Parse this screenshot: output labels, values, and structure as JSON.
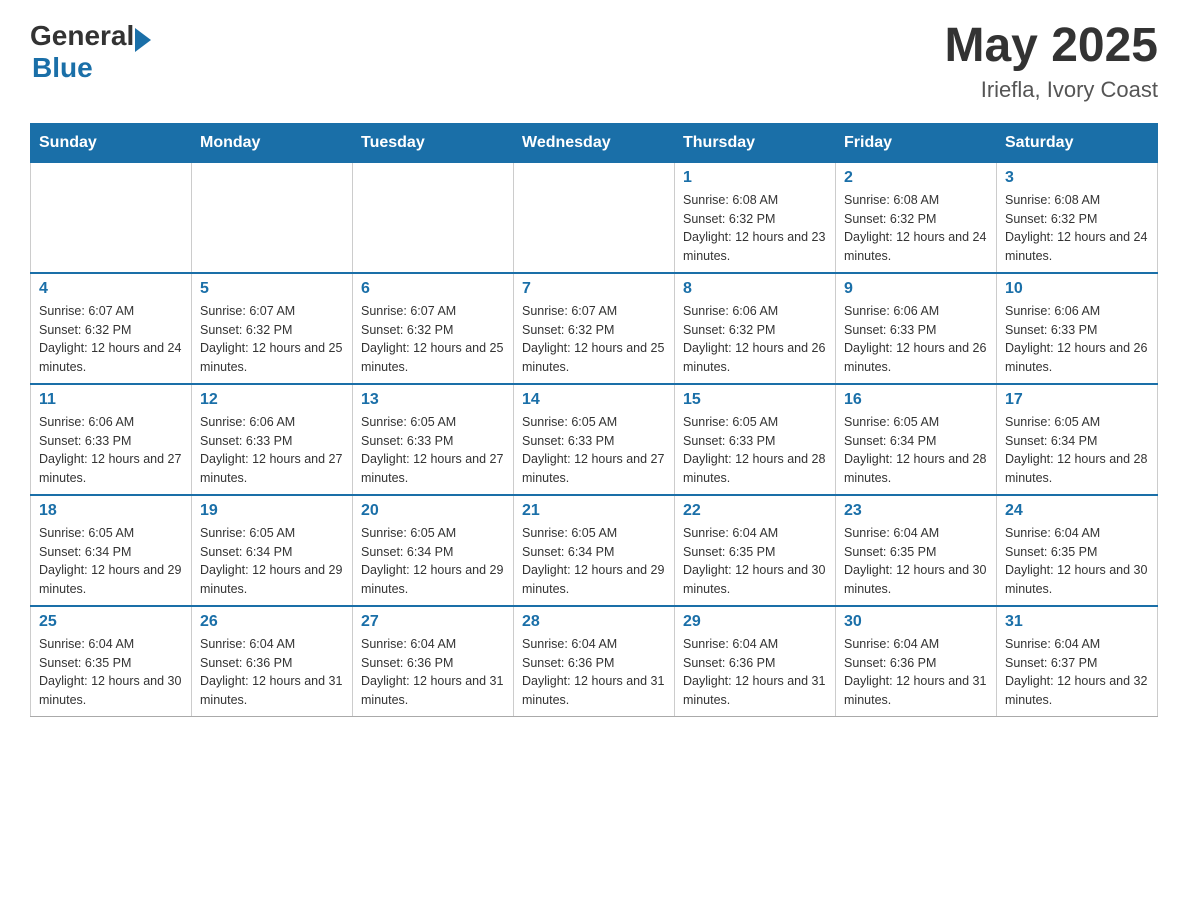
{
  "header": {
    "month_year": "May 2025",
    "location": "Iriefla, Ivory Coast",
    "logo_general": "General",
    "logo_blue": "Blue"
  },
  "days_of_week": [
    "Sunday",
    "Monday",
    "Tuesday",
    "Wednesday",
    "Thursday",
    "Friday",
    "Saturday"
  ],
  "weeks": [
    {
      "days": [
        {
          "number": "",
          "info": ""
        },
        {
          "number": "",
          "info": ""
        },
        {
          "number": "",
          "info": ""
        },
        {
          "number": "",
          "info": ""
        },
        {
          "number": "1",
          "info": "Sunrise: 6:08 AM\nSunset: 6:32 PM\nDaylight: 12 hours and 23 minutes."
        },
        {
          "number": "2",
          "info": "Sunrise: 6:08 AM\nSunset: 6:32 PM\nDaylight: 12 hours and 24 minutes."
        },
        {
          "number": "3",
          "info": "Sunrise: 6:08 AM\nSunset: 6:32 PM\nDaylight: 12 hours and 24 minutes."
        }
      ]
    },
    {
      "days": [
        {
          "number": "4",
          "info": "Sunrise: 6:07 AM\nSunset: 6:32 PM\nDaylight: 12 hours and 24 minutes."
        },
        {
          "number": "5",
          "info": "Sunrise: 6:07 AM\nSunset: 6:32 PM\nDaylight: 12 hours and 25 minutes."
        },
        {
          "number": "6",
          "info": "Sunrise: 6:07 AM\nSunset: 6:32 PM\nDaylight: 12 hours and 25 minutes."
        },
        {
          "number": "7",
          "info": "Sunrise: 6:07 AM\nSunset: 6:32 PM\nDaylight: 12 hours and 25 minutes."
        },
        {
          "number": "8",
          "info": "Sunrise: 6:06 AM\nSunset: 6:32 PM\nDaylight: 12 hours and 26 minutes."
        },
        {
          "number": "9",
          "info": "Sunrise: 6:06 AM\nSunset: 6:33 PM\nDaylight: 12 hours and 26 minutes."
        },
        {
          "number": "10",
          "info": "Sunrise: 6:06 AM\nSunset: 6:33 PM\nDaylight: 12 hours and 26 minutes."
        }
      ]
    },
    {
      "days": [
        {
          "number": "11",
          "info": "Sunrise: 6:06 AM\nSunset: 6:33 PM\nDaylight: 12 hours and 27 minutes."
        },
        {
          "number": "12",
          "info": "Sunrise: 6:06 AM\nSunset: 6:33 PM\nDaylight: 12 hours and 27 minutes."
        },
        {
          "number": "13",
          "info": "Sunrise: 6:05 AM\nSunset: 6:33 PM\nDaylight: 12 hours and 27 minutes."
        },
        {
          "number": "14",
          "info": "Sunrise: 6:05 AM\nSunset: 6:33 PM\nDaylight: 12 hours and 27 minutes."
        },
        {
          "number": "15",
          "info": "Sunrise: 6:05 AM\nSunset: 6:33 PM\nDaylight: 12 hours and 28 minutes."
        },
        {
          "number": "16",
          "info": "Sunrise: 6:05 AM\nSunset: 6:34 PM\nDaylight: 12 hours and 28 minutes."
        },
        {
          "number": "17",
          "info": "Sunrise: 6:05 AM\nSunset: 6:34 PM\nDaylight: 12 hours and 28 minutes."
        }
      ]
    },
    {
      "days": [
        {
          "number": "18",
          "info": "Sunrise: 6:05 AM\nSunset: 6:34 PM\nDaylight: 12 hours and 29 minutes."
        },
        {
          "number": "19",
          "info": "Sunrise: 6:05 AM\nSunset: 6:34 PM\nDaylight: 12 hours and 29 minutes."
        },
        {
          "number": "20",
          "info": "Sunrise: 6:05 AM\nSunset: 6:34 PM\nDaylight: 12 hours and 29 minutes."
        },
        {
          "number": "21",
          "info": "Sunrise: 6:05 AM\nSunset: 6:34 PM\nDaylight: 12 hours and 29 minutes."
        },
        {
          "number": "22",
          "info": "Sunrise: 6:04 AM\nSunset: 6:35 PM\nDaylight: 12 hours and 30 minutes."
        },
        {
          "number": "23",
          "info": "Sunrise: 6:04 AM\nSunset: 6:35 PM\nDaylight: 12 hours and 30 minutes."
        },
        {
          "number": "24",
          "info": "Sunrise: 6:04 AM\nSunset: 6:35 PM\nDaylight: 12 hours and 30 minutes."
        }
      ]
    },
    {
      "days": [
        {
          "number": "25",
          "info": "Sunrise: 6:04 AM\nSunset: 6:35 PM\nDaylight: 12 hours and 30 minutes."
        },
        {
          "number": "26",
          "info": "Sunrise: 6:04 AM\nSunset: 6:36 PM\nDaylight: 12 hours and 31 minutes."
        },
        {
          "number": "27",
          "info": "Sunrise: 6:04 AM\nSunset: 6:36 PM\nDaylight: 12 hours and 31 minutes."
        },
        {
          "number": "28",
          "info": "Sunrise: 6:04 AM\nSunset: 6:36 PM\nDaylight: 12 hours and 31 minutes."
        },
        {
          "number": "29",
          "info": "Sunrise: 6:04 AM\nSunset: 6:36 PM\nDaylight: 12 hours and 31 minutes."
        },
        {
          "number": "30",
          "info": "Sunrise: 6:04 AM\nSunset: 6:36 PM\nDaylight: 12 hours and 31 minutes."
        },
        {
          "number": "31",
          "info": "Sunrise: 6:04 AM\nSunset: 6:37 PM\nDaylight: 12 hours and 32 minutes."
        }
      ]
    }
  ]
}
